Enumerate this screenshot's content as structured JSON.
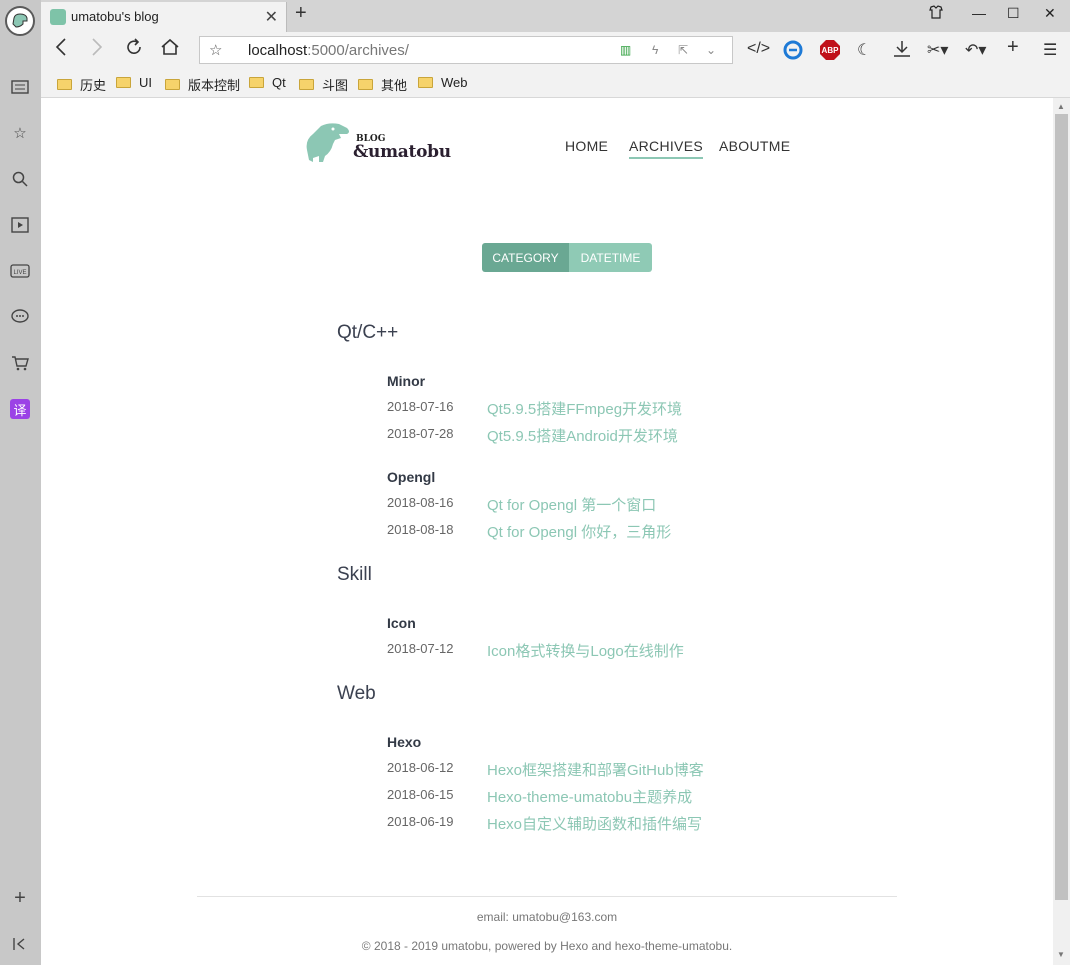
{
  "browser": {
    "tab_title": "umatobu's blog",
    "url_host": "localhost",
    "url_rest": ":5000/archives/",
    "bookmarks": [
      "历史",
      "UI",
      "版本控制",
      "Qt",
      "斗图",
      "其他",
      "Web"
    ]
  },
  "header": {
    "logo_small": "BLOG",
    "logo_name": "&umatobu",
    "nav": [
      "HOME",
      "ARCHIVES",
      "ABOUTME"
    ],
    "active_nav": "ARCHIVES"
  },
  "toggle": {
    "category": "CATEGORY",
    "datetime": "DATETIME",
    "active": "CATEGORY"
  },
  "archives": {
    "categories": [
      {
        "name": "Qt/C++",
        "groups": [
          {
            "name": "Minor",
            "posts": [
              {
                "date": "2018-07-16",
                "title": "Qt5.9.5搭建FFmpeg开发环境"
              },
              {
                "date": "2018-07-28",
                "title": "Qt5.9.5搭建Android开发环境"
              }
            ]
          },
          {
            "name": "Opengl",
            "posts": [
              {
                "date": "2018-08-16",
                "title": "Qt for Opengl 第一个窗口"
              },
              {
                "date": "2018-08-18",
                "title": "Qt for Opengl 你好，三角形"
              }
            ]
          }
        ]
      },
      {
        "name": "Skill",
        "groups": [
          {
            "name": "Icon",
            "posts": [
              {
                "date": "2018-07-12",
                "title": "Icon格式转换与Logo在线制作"
              }
            ]
          }
        ]
      },
      {
        "name": "Web",
        "groups": [
          {
            "name": "Hexo",
            "posts": [
              {
                "date": "2018-06-12",
                "title": "Hexo框架搭建和部署GitHub博客"
              },
              {
                "date": "2018-06-15",
                "title": "Hexo-theme-umatobu主题养成"
              },
              {
                "date": "2018-06-19",
                "title": "Hexo自定义辅助函数和插件编写"
              }
            ]
          }
        ]
      }
    ]
  },
  "footer": {
    "email": "email: umatobu@163.com",
    "copyright": "© 2018 - 2019 umatobu, powered by Hexo and hexo-theme-umatobu."
  },
  "colors": {
    "accent": "#8cc7b4",
    "accent_dark": "#6aa893"
  }
}
